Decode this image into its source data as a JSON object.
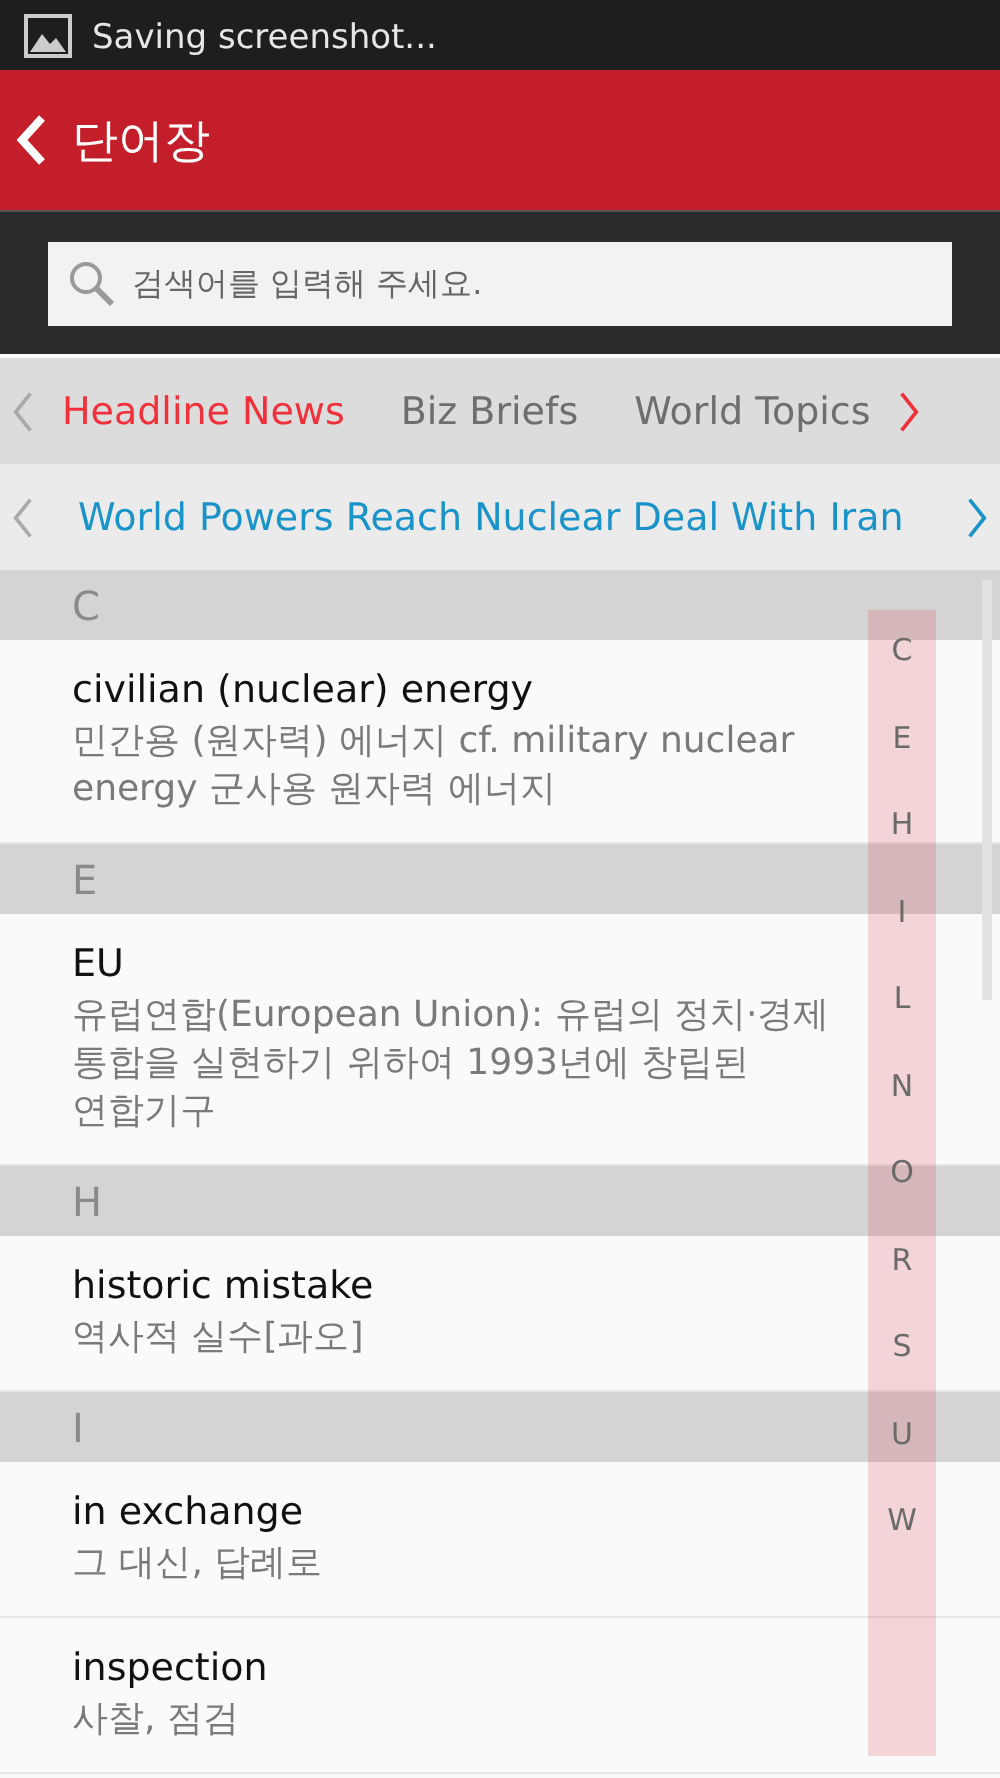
{
  "notification": {
    "text": "Saving screenshot..."
  },
  "header": {
    "title": "단어장"
  },
  "search": {
    "placeholder": "검색어를 입력해 주세요."
  },
  "tabs": [
    {
      "label": "Headline News",
      "selected": true
    },
    {
      "label": "Biz Briefs",
      "selected": false
    },
    {
      "label": "World Topics",
      "selected": false
    }
  ],
  "headline": {
    "title": "World Powers Reach Nuclear Deal With Iran"
  },
  "sections": [
    {
      "letter": "C",
      "entries": [
        {
          "word": "civilian (nuclear) energy",
          "meaning": "민간용 (원자력) 에너지 cf. military nuclear energy 군사용 원자력 에너지"
        }
      ]
    },
    {
      "letter": "E",
      "entries": [
        {
          "word": "EU",
          "meaning": "유럽연합(European Union): 유럽의 정치·경제 통합을 실현하기 위하여 1993년에 창립된 연합기구"
        }
      ]
    },
    {
      "letter": "H",
      "entries": [
        {
          "word": "historic mistake",
          "meaning": "역사적 실수[과오]"
        }
      ]
    },
    {
      "letter": "I",
      "entries": [
        {
          "word": "in exchange",
          "meaning": "그 대신, 답례로"
        },
        {
          "word": "inspection",
          "meaning": "사찰, 점검"
        }
      ]
    }
  ],
  "index": [
    "C",
    "E",
    "H",
    "I",
    "L",
    "N",
    "O",
    "R",
    "S",
    "U",
    "W"
  ]
}
